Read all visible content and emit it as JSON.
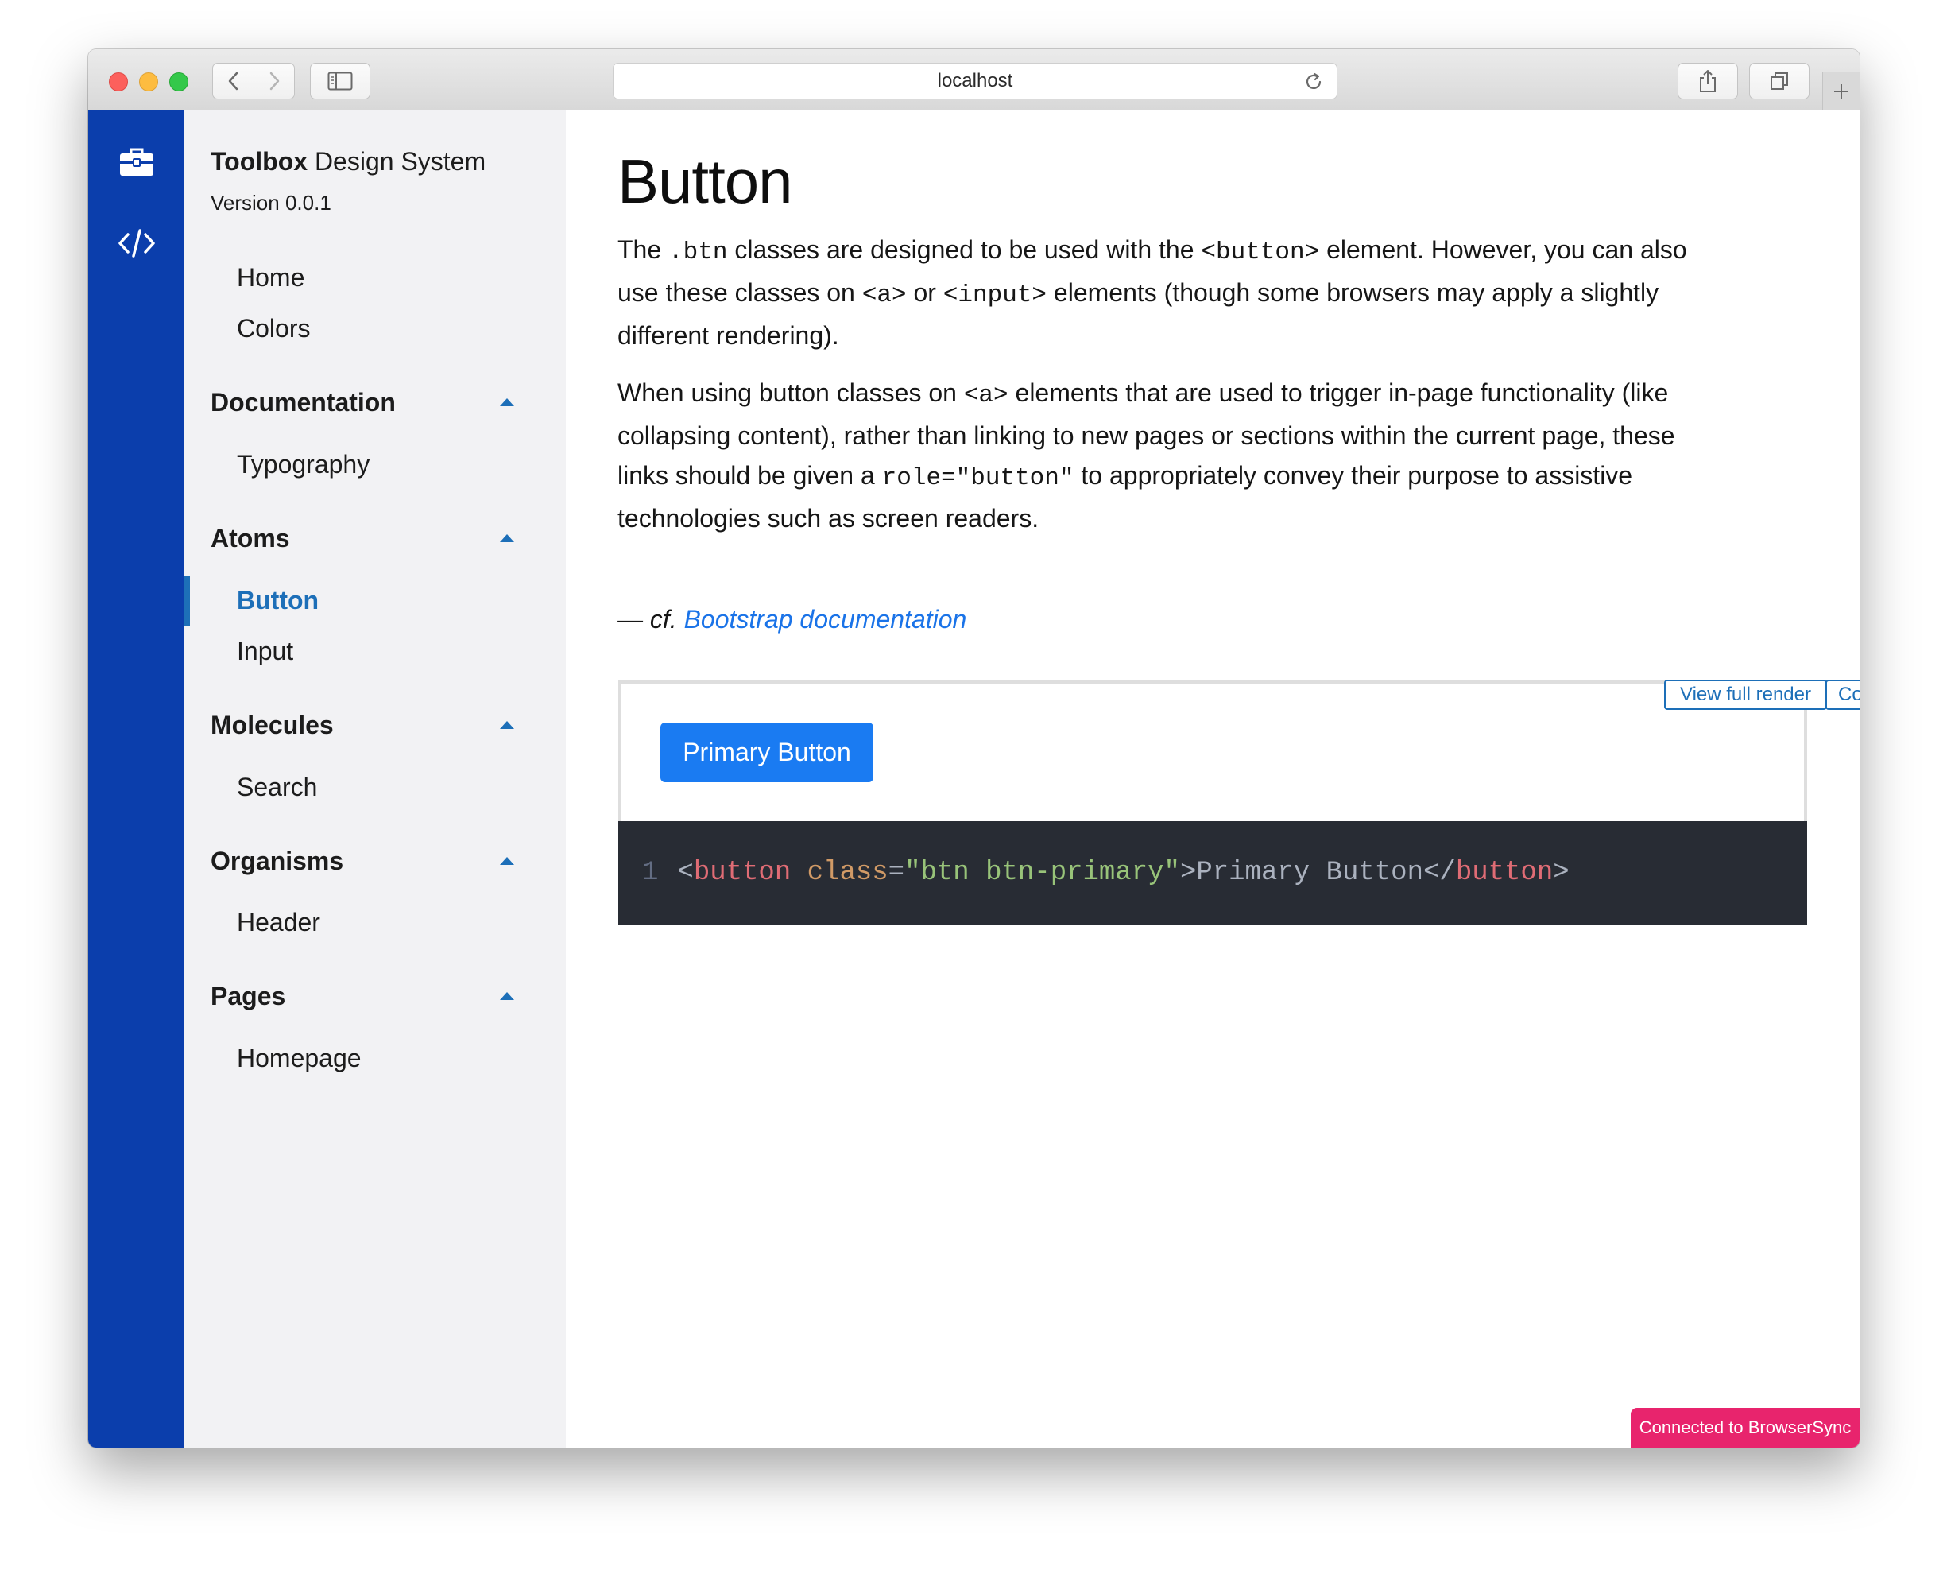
{
  "browser": {
    "url": "localhost"
  },
  "sidebar": {
    "brand_bold": "Toolbox",
    "brand_rest": " Design System",
    "version": "Version 0.0.1",
    "top_links": [
      "Home",
      "Colors"
    ],
    "sections": [
      {
        "title": "Documentation",
        "items": [
          "Typography"
        ]
      },
      {
        "title": "Atoms",
        "items": [
          "Button",
          "Input"
        ]
      },
      {
        "title": "Molecules",
        "items": [
          "Search"
        ]
      },
      {
        "title": "Organisms",
        "items": [
          "Header"
        ]
      },
      {
        "title": "Pages",
        "items": [
          "Homepage"
        ]
      }
    ],
    "active_item": "Button"
  },
  "main": {
    "title": "Button",
    "para1": {
      "t1": "The ",
      "c1": ".btn",
      "t2": " classes are designed to be used with the ",
      "c2": "<button>",
      "t3": " element. However, you can also use these classes on ",
      "c3": "<a>",
      "t4": " or ",
      "c4": "<input>",
      "t5": " elements (though some browsers may apply a slightly different rendering)."
    },
    "para2": {
      "t1": "When using button classes on ",
      "c1": "<a>",
      "t2": " elements that are used to trigger in-page functionality (like collapsing content), rather than linking to new pages or sections within the current page, these links should be given a ",
      "c2": "role=\"button\"",
      "t3": " to appropriately convey their purpose to assistive technologies such as screen readers."
    },
    "cite_prefix": "— cf. ",
    "cite_link": "Bootstrap documentation",
    "preview": {
      "view_full_render": "View full render",
      "copy": "Copy",
      "primary_button": "Primary Button"
    },
    "code": {
      "line_number": "1",
      "open_bracket": "<",
      "tag_open": "button",
      "space": " ",
      "attr": "class",
      "eq": "=",
      "value": "\"btn btn-primary\"",
      "gt": ">",
      "text": "Primary Button",
      "close_open": "</",
      "tag_close": "button",
      "close_gt": ">"
    }
  },
  "browsersync_badge": "Connected to BrowserSync",
  "colors": {
    "rail": "#0b3eac",
    "accent": "#1d6fb8",
    "primary_button": "#1a7bf2",
    "code_bg": "#282c34",
    "badge": "#e8246d"
  }
}
